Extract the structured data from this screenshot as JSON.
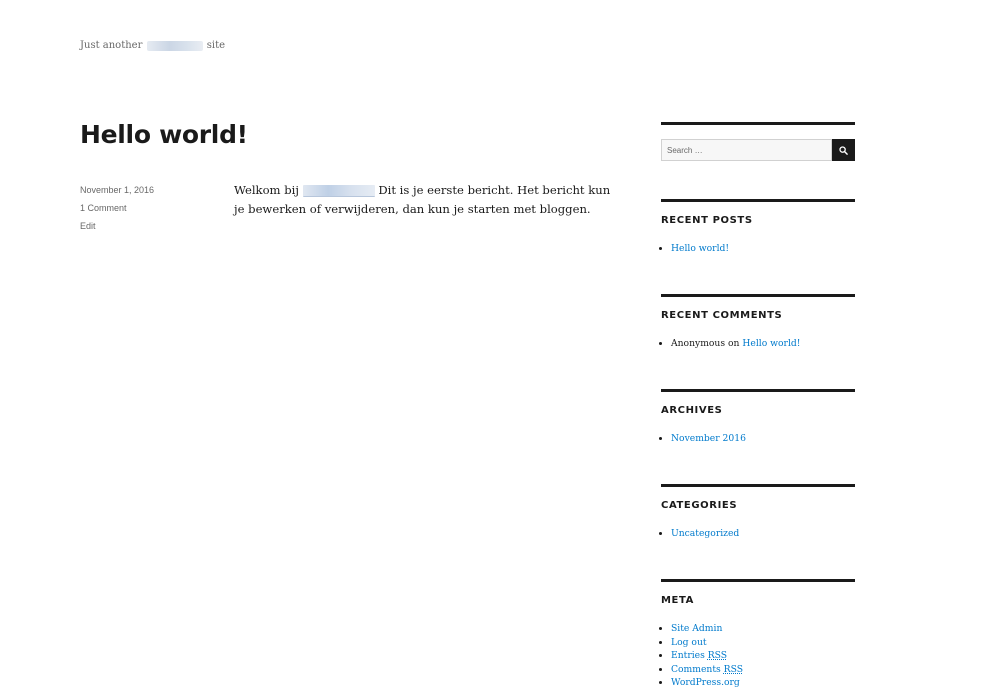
{
  "site": {
    "tagline_prefix": "Just another",
    "tagline_suffix": "site"
  },
  "post": {
    "title": "Hello world!",
    "date": "November 1, 2016",
    "comments": "1 Comment",
    "edit": "Edit",
    "content_prefix": "Welkom bij",
    "content_rest": " Dit is je eerste bericht. Het bericht kun je bewerken of verwijderen, dan kun je starten met bloggen."
  },
  "sidebar": {
    "search": {
      "placeholder": "Search …",
      "button_icon": "search-icon"
    },
    "recent_posts": {
      "title": "RECENT POSTS",
      "items": [
        "Hello world!"
      ]
    },
    "recent_comments": {
      "title": "RECENT COMMENTS",
      "author": "Anonymous",
      "on": "on",
      "post": "Hello world!"
    },
    "archives": {
      "title": "ARCHIVES",
      "items": [
        "November 2016"
      ]
    },
    "categories": {
      "title": "CATEGORIES",
      "items": [
        "Uncategorized"
      ]
    },
    "meta": {
      "title": "META",
      "site_admin": "Site Admin",
      "log_out": "Log out",
      "entries": "Entries",
      "comments": "Comments",
      "rss": "RSS",
      "wordpress": "WordPress.org"
    }
  },
  "colors": {
    "link": "#007acc",
    "text": "#1a1a1a",
    "meta": "#686868",
    "divider": "#1a1a1a"
  }
}
